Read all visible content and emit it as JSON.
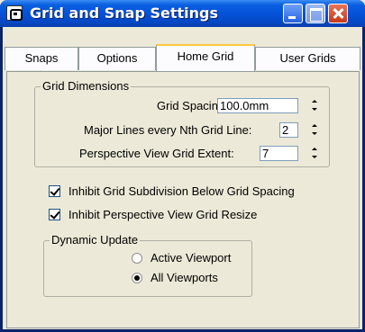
{
  "window": {
    "title": "Grid and Snap Settings",
    "icon": "grid-snap-app-icon",
    "controls": [
      "minimize-icon",
      "maximize-icon",
      "close-icon"
    ]
  },
  "tabs": [
    {
      "label": "Snaps",
      "active": false
    },
    {
      "label": "Options",
      "active": false
    },
    {
      "label": "Home Grid",
      "active": true
    },
    {
      "label": "User Grids",
      "active": false
    }
  ],
  "grid_dimensions": {
    "legend": "Grid Dimensions",
    "grid_spacing": {
      "label": "Grid Spacing:",
      "value": "100.0mm"
    },
    "major_lines": {
      "label": "Major Lines every Nth Grid Line:",
      "value": "2"
    },
    "perspective_extent": {
      "label": "Perspective View Grid Extent:",
      "value": "7"
    }
  },
  "options": {
    "inhibit_subdivision": {
      "label": "Inhibit Grid Subdivision Below Grid Spacing",
      "checked": true
    },
    "inhibit_resize": {
      "label": "Inhibit Perspective View Grid Resize",
      "checked": true
    }
  },
  "dynamic_update": {
    "legend": "Dynamic Update",
    "options": [
      {
        "label": "Active Viewport",
        "selected": false
      },
      {
        "label": "All Viewports",
        "selected": true
      }
    ]
  },
  "colors": {
    "titlebar": "#0452D9",
    "dialog_bg": "#ECE9D8",
    "tab_highlight": "#FFC83C",
    "close_button": "#C5391A"
  }
}
